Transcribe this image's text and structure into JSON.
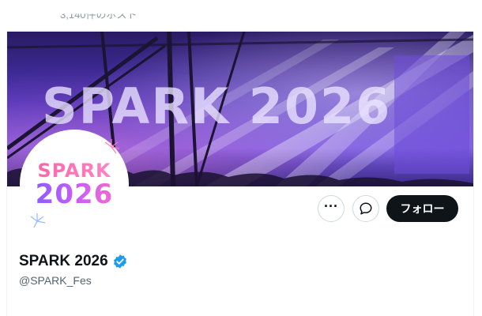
{
  "header": {
    "post_count": "3,140件のポスト"
  },
  "banner": {
    "stage_text": "SPARK 2026",
    "colors": {
      "primary": "#4b34b8",
      "light_beam": "#e9e2ff"
    }
  },
  "avatar": {
    "logo_word": "SPARK",
    "logo_year": "2026",
    "colors": {
      "pink": "#ff5fa8",
      "purple": "#7b5cff"
    }
  },
  "actions": {
    "more_icon": "more-horizontal-icon",
    "more_glyph": "···",
    "message_icon": "message-bubble-icon",
    "follow_label": "フォロー"
  },
  "profile": {
    "display_name": "SPARK 2026",
    "verified_icon": "verified-badge-icon",
    "verified_color": "#1d9bf0",
    "handle": "@SPARK_Fes"
  }
}
